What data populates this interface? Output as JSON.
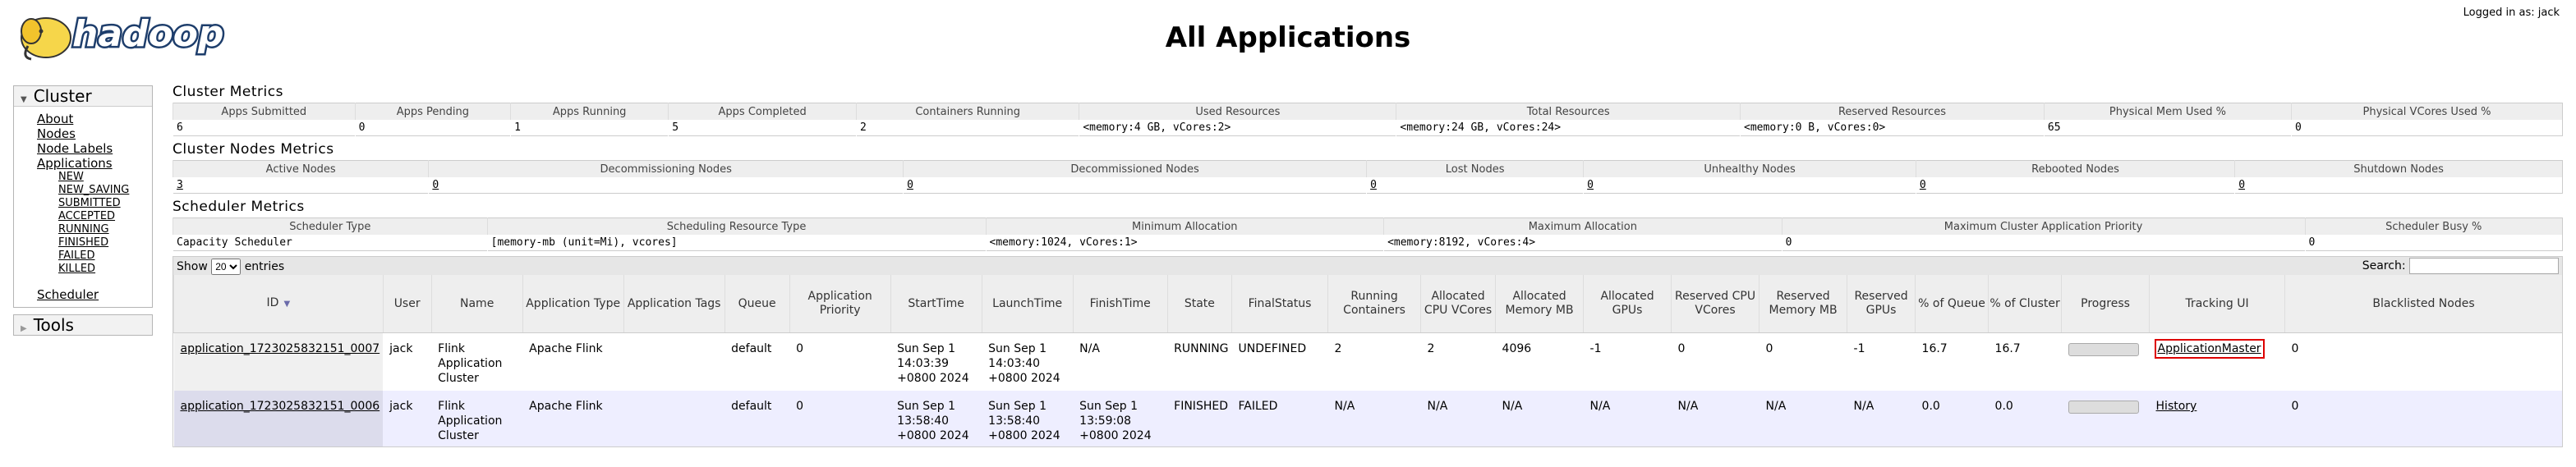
{
  "header": {
    "logo_text": "hadoop",
    "title": "All Applications",
    "login": "Logged in as: jack"
  },
  "sidebar": {
    "cluster_label": "Cluster",
    "links": [
      "About",
      "Nodes",
      "Node Labels",
      "Applications"
    ],
    "app_states": [
      "NEW",
      "NEW_SAVING",
      "SUBMITTED",
      "ACCEPTED",
      "RUNNING",
      "FINISHED",
      "FAILED",
      "KILLED"
    ],
    "scheduler_label": "Scheduler",
    "tools_label": "Tools"
  },
  "cluster_metrics": {
    "title": "Cluster Metrics",
    "headers": [
      "Apps Submitted",
      "Apps Pending",
      "Apps Running",
      "Apps Completed",
      "Containers Running",
      "Used Resources",
      "Total Resources",
      "Reserved Resources",
      "Physical Mem Used %",
      "Physical VCores Used %"
    ],
    "values": [
      "6",
      "0",
      "1",
      "5",
      "2",
      "<memory:4 GB, vCores:2>",
      "<memory:24 GB, vCores:24>",
      "<memory:0 B, vCores:0>",
      "65",
      "0"
    ]
  },
  "nodes_metrics": {
    "title": "Cluster Nodes Metrics",
    "headers": [
      "Active Nodes",
      "Decommissioning Nodes",
      "Decommissioned Nodes",
      "Lost Nodes",
      "Unhealthy Nodes",
      "Rebooted Nodes",
      "Shutdown Nodes"
    ],
    "values": [
      "3",
      "0",
      "0",
      "0",
      "0",
      "0",
      "0"
    ]
  },
  "scheduler_metrics": {
    "title": "Scheduler Metrics",
    "headers": [
      "Scheduler Type",
      "Scheduling Resource Type",
      "Minimum Allocation",
      "Maximum Allocation",
      "Maximum Cluster Application Priority",
      "Scheduler Busy %"
    ],
    "values": [
      "Capacity Scheduler",
      "[memory-mb (unit=Mi), vcores]",
      "<memory:1024, vCores:1>",
      "<memory:8192, vCores:4>",
      "0",
      "0"
    ]
  },
  "apps": {
    "show_label": "Show",
    "entries_value": "20",
    "entries_label": "entries",
    "search_label": "Search:",
    "search_value": "",
    "columns": [
      "ID",
      "User",
      "Name",
      "Application Type",
      "Application Tags",
      "Queue",
      "Application Priority",
      "StartTime",
      "LaunchTime",
      "FinishTime",
      "State",
      "FinalStatus",
      "Running Containers",
      "Allocated CPU VCores",
      "Allocated Memory MB",
      "Allocated GPUs",
      "Reserved CPU VCores",
      "Reserved Memory MB",
      "Reserved GPUs",
      "% of Queue",
      "% of Cluster",
      "Progress",
      "Tracking UI",
      "Blacklisted Nodes"
    ],
    "rows": [
      {
        "id": "application_1723025832151_0007",
        "user": "jack",
        "name": "Flink Application Cluster",
        "type": "Apache Flink",
        "tags": "",
        "queue": "default",
        "priority": "0",
        "start": "Sun Sep 1 14:03:39 +0800 2024",
        "launch": "Sun Sep 1 14:03:40 +0800 2024",
        "finish": "N/A",
        "state": "RUNNING",
        "final": "UNDEFINED",
        "running_containers": "2",
        "alloc_vcores": "2",
        "alloc_mem": "4096",
        "alloc_gpus": "-1",
        "res_vcores": "0",
        "res_mem": "0",
        "res_gpus": "-1",
        "pct_queue": "16.7",
        "pct_cluster": "16.7",
        "tracking": "ApplicationMaster",
        "blacklisted": "0"
      },
      {
        "id": "application_1723025832151_0006",
        "user": "jack",
        "name": "Flink Application Cluster",
        "type": "Apache Flink",
        "tags": "",
        "queue": "default",
        "priority": "0",
        "start": "Sun Sep 1 13:58:40 +0800 2024",
        "launch": "Sun Sep 1 13:58:40 +0800 2024",
        "finish": "Sun Sep 1 13:59:08 +0800 2024",
        "state": "FINISHED",
        "final": "FAILED",
        "running_containers": "N/A",
        "alloc_vcores": "N/A",
        "alloc_mem": "N/A",
        "alloc_gpus": "N/A",
        "res_vcores": "N/A",
        "res_mem": "N/A",
        "res_gpus": "N/A",
        "pct_queue": "0.0",
        "pct_cluster": "0.0",
        "tracking": "History",
        "blacklisted": "0"
      }
    ]
  },
  "colors": {
    "highlight": "#dd0000",
    "header_bg": "#eeeeee",
    "row_alt": "#eeeeff"
  },
  "icons": [
    "hadoop-elephant-logo",
    "expand-triangle-icon",
    "collapse-triangle-icon",
    "sort-arrow-icon"
  ]
}
